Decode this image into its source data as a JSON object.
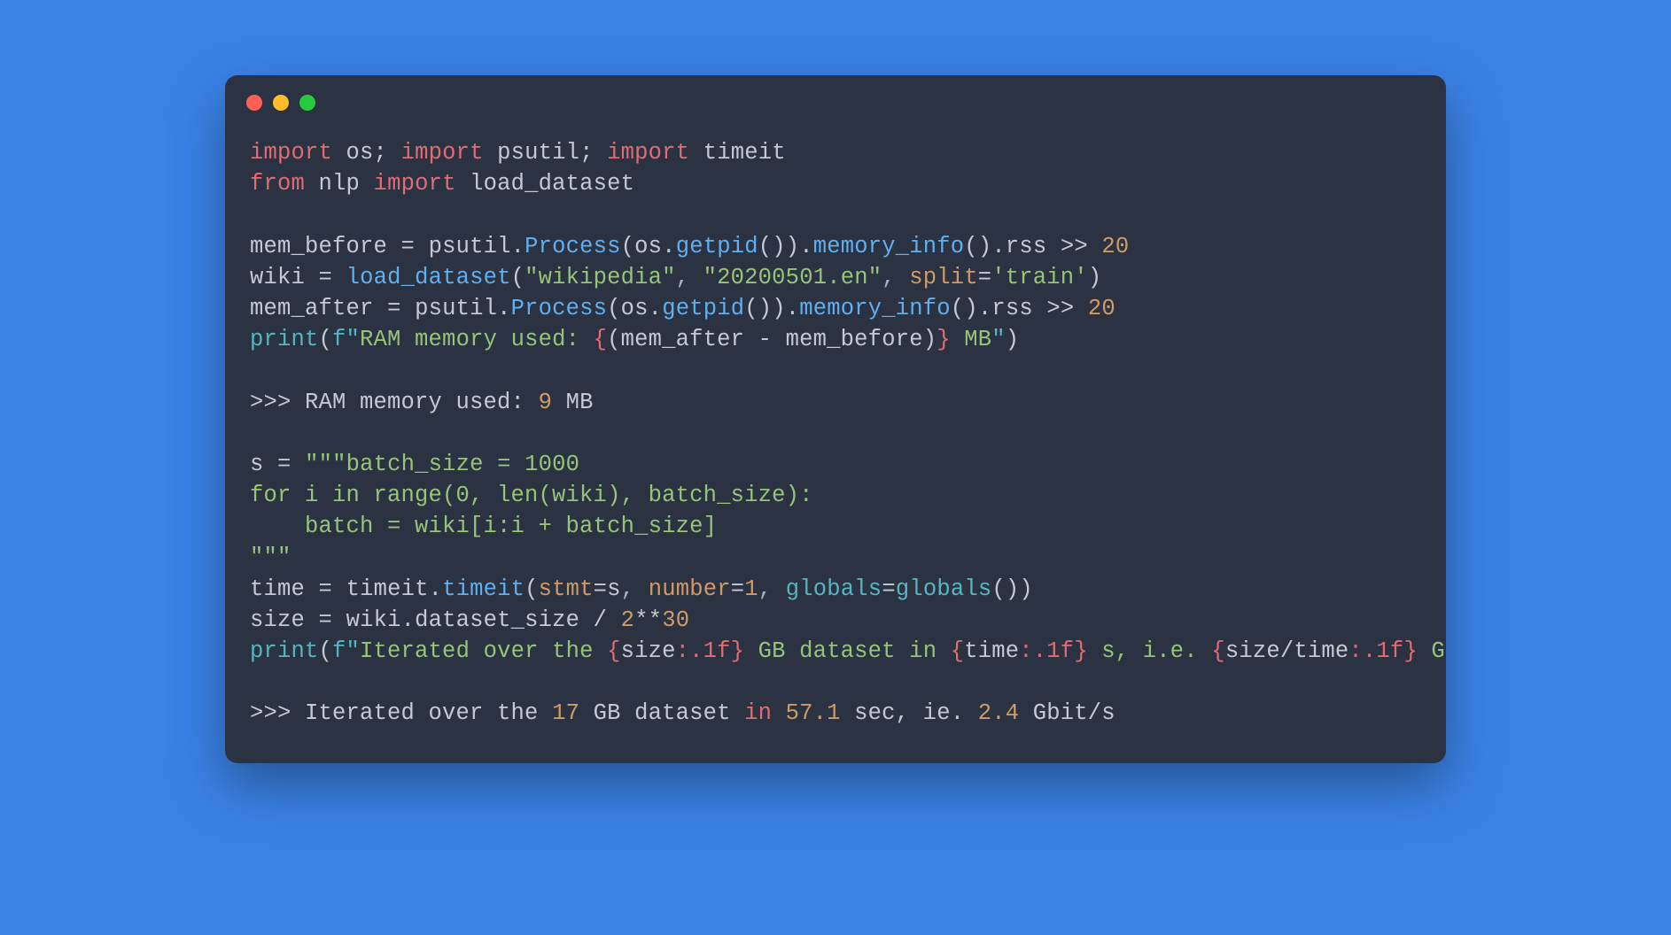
{
  "window": {
    "dots": [
      "red",
      "yellow",
      "green"
    ]
  },
  "code": {
    "line1": {
      "import1": "import",
      "os": "os",
      "semi1": ";",
      "import2": "import",
      "psutil": "psutil",
      "semi2": ";",
      "import3": "import",
      "timeit": "timeit"
    },
    "line2": {
      "from": "from",
      "nlp": "nlp",
      "import": "import",
      "load_dataset": "load_dataset"
    },
    "line3": {
      "mem_before": "mem_before",
      "eq": "=",
      "psutil": "psutil",
      "dot1": ".",
      "process": "Process",
      "lp1": "(",
      "os": "os",
      "dot2": ".",
      "getpid": "getpid",
      "lp2": "(",
      "rp2": ")",
      "rp1": ")",
      "dot3": ".",
      "memory_info": "memory_info",
      "lp3": "(",
      "rp3": ")",
      "dot4": ".",
      "rss": "rss",
      "rshift": ">>",
      "twenty": "20"
    },
    "line4": {
      "wiki": "wiki",
      "eq": "=",
      "load_dataset": "load_dataset",
      "lp": "(",
      "arg1": "\"wikipedia\"",
      "c1": ",",
      "arg2": "\"20200501.en\"",
      "c2": ",",
      "split": "split",
      "eq2": "=",
      "train": "'train'",
      "rp": ")"
    },
    "line5": {
      "mem_after": "mem_after",
      "eq": "=",
      "psutil": "psutil",
      "dot1": ".",
      "process": "Process",
      "lp1": "(",
      "os": "os",
      "dot2": ".",
      "getpid": "getpid",
      "lp2": "(",
      "rp2": ")",
      "rp1": ")",
      "dot3": ".",
      "memory_info": "memory_info",
      "lp3": "(",
      "rp3": ")",
      "dot4": ".",
      "rss": "rss",
      "rshift": ">>",
      "twenty": "20"
    },
    "line6": {
      "print": "print",
      "lp": "(",
      "f": "f\"",
      "text1": "RAM memory used: ",
      "lb": "{",
      "expr_lp": "(",
      "ma": "mem_after",
      "minus": " - ",
      "mb": "mem_before",
      "expr_rp": ")",
      "rb": "}",
      "text2": " MB",
      "endq": "\"",
      "rp": ")"
    },
    "line7": {
      "prompt": ">>>",
      "text1": " RAM memory used: ",
      "nine": "9",
      "text2": " MB"
    },
    "line8": {
      "s": "s",
      "eq": "=",
      "triple": "\"\"\"",
      "content1": "batch_size = 1000",
      "content2": "for i in range(0, len(wiki), batch_size):",
      "content3": "    batch = wiki[i:i + batch_size]",
      "triple_end": "\"\"\""
    },
    "line9": {
      "time": "time",
      "eq": "=",
      "timeit": "timeit",
      "dot": ".",
      "timeit2": "timeit",
      "lp": "(",
      "stmt": "stmt",
      "eq2": "=",
      "s": "s",
      "c1": ",",
      "number": "number",
      "eq3": "=",
      "one": "1",
      "c2": ",",
      "globals": "globals",
      "eq4": "=",
      "globals2": "globals",
      "lp2": "(",
      "rp2": ")",
      "rp": ")"
    },
    "line10": {
      "size": "size",
      "eq": "=",
      "wiki": "wiki",
      "dot": ".",
      "dataset_size": "dataset_size",
      "div": "/",
      "two": "2",
      "pow": "**",
      "thirty": "30"
    },
    "line11": {
      "print": "print",
      "lp": "(",
      "f": "f\"",
      "text1": "Iterated over the ",
      "lb1": "{",
      "size": "size",
      "fmt1": ":.1f",
      "rb1": "}",
      "text2": " GB dataset in ",
      "lb2": "{",
      "time": "time",
      "fmt2": ":.1f",
      "rb2": "}",
      "text3": " s, i.e. ",
      "lb3": "{",
      "size2": "size",
      "div": "/",
      "time2": "time",
      "fmt3": ":.1f",
      "rb3": "}",
      "text4": " Gbit/s",
      "endq": "\"",
      "rp": ")"
    },
    "line12": {
      "prompt": ">>>",
      "text1": " Iterated over the ",
      "seventeen": "17",
      "text2": " GB dataset ",
      "in": "in",
      "text3": " ",
      "val1": "57.1",
      "text4": " sec, ie. ",
      "val2": "2.4",
      "text5": " Gbit/s"
    }
  }
}
